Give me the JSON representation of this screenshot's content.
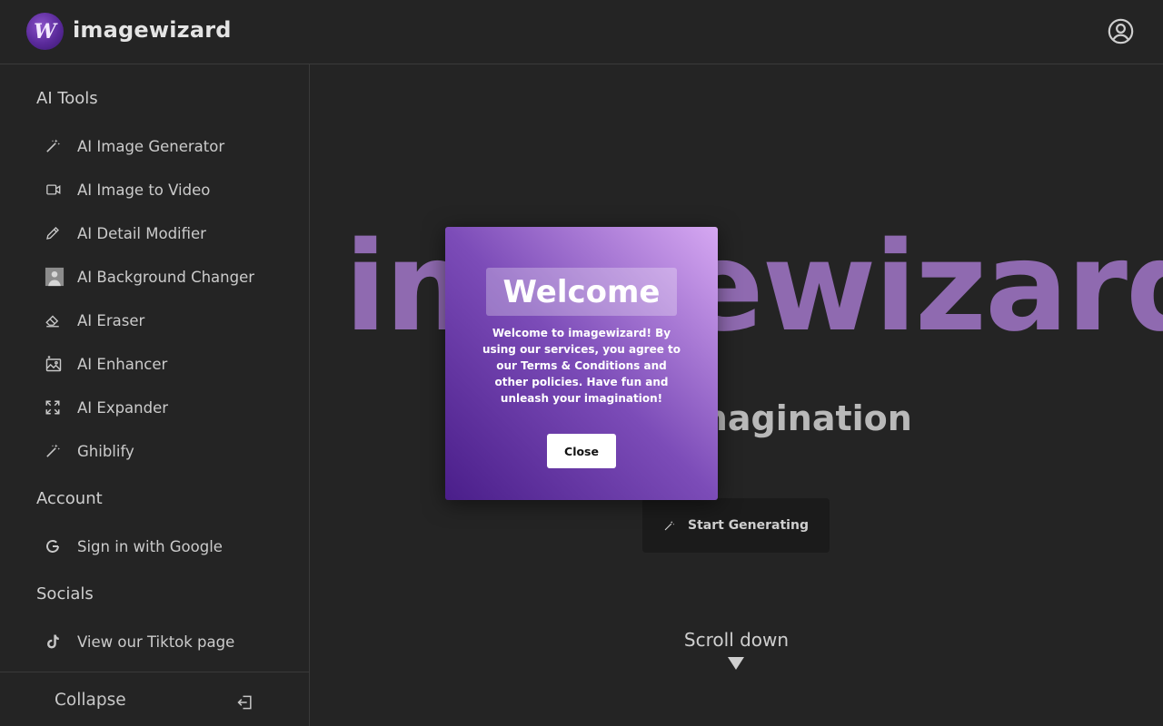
{
  "header": {
    "logo_letter": "W",
    "brand": "imagewizard",
    "user_icon": "user-circle-icon"
  },
  "sidebar": {
    "sections": [
      {
        "title": "AI Tools",
        "items": [
          {
            "label": "AI Image Generator",
            "icon": "magic-wand-icon"
          },
          {
            "label": "AI Image to Video",
            "icon": "video-camera-icon"
          },
          {
            "label": "AI Detail Modifier",
            "icon": "pencil-icon"
          },
          {
            "label": "AI Background Changer",
            "icon": "portrait-icon"
          },
          {
            "label": "AI Eraser",
            "icon": "eraser-icon"
          },
          {
            "label": "AI Enhancer",
            "icon": "image-sparkle-icon"
          },
          {
            "label": "AI Expander",
            "icon": "expand-icon"
          },
          {
            "label": "Ghiblify",
            "icon": "magic-wand-icon"
          }
        ]
      },
      {
        "title": "Account",
        "items": [
          {
            "label": "Sign in with Google",
            "icon": "google-icon"
          }
        ]
      },
      {
        "title": "Socials",
        "items": [
          {
            "label": "View our Tiktok page",
            "icon": "tiktok-icon"
          }
        ]
      }
    ],
    "collapse_label": "Collapse"
  },
  "main": {
    "hero_title": "imagewizard",
    "hero_subtitle": "r Imagination",
    "start_button": "Start Generating",
    "scroll_label": "Scroll down"
  },
  "modal": {
    "title": "Welcome",
    "text": "Welcome to imagewizard! By using our services, you agree to our Terms & Conditions and other policies. Have fun and unleash your imagination!",
    "close_label": "Close"
  },
  "colors": {
    "background": "#242424",
    "hero_text": "#8f6ab0",
    "modal_gradient_start": "#4a1e8a",
    "modal_gradient_end": "#d6a8f2"
  }
}
